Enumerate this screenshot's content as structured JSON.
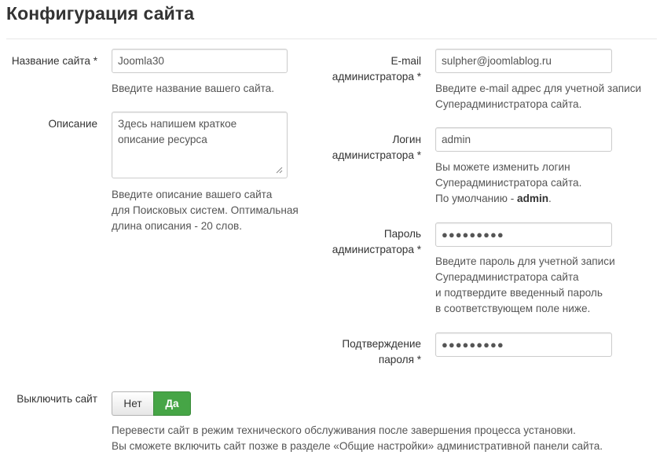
{
  "page_title": "Конфигурация сайта",
  "left": {
    "site_name": {
      "label": "Название сайта *",
      "value": "Joomla30",
      "help": "Введите название вашего сайта."
    },
    "description": {
      "label": "Описание",
      "value": "Здесь напишем краткое описание ресурса",
      "help": [
        "Введите описание вашего сайта",
        "для Поисковых систем. Оптимальная",
        "длина описания - 20 слов."
      ]
    }
  },
  "right": {
    "admin_email": {
      "label": [
        "E-mail",
        "администратора *"
      ],
      "value": "sulpher@joomlablog.ru",
      "help": [
        "Введите e-mail адрес для учетной записи",
        "Суперадминистратора сайта."
      ]
    },
    "admin_login": {
      "label": [
        "Логин",
        "администратора *"
      ],
      "value": "admin",
      "help": [
        "Вы можете изменить логин",
        "Суперадминистратора сайта."
      ],
      "help_default_prefix": "По умолчанию - ",
      "help_default_value": "admin",
      "help_default_suffix": "."
    },
    "admin_password": {
      "label": [
        "Пароль",
        "администратора *"
      ],
      "value": "●●●●●●●●●",
      "help": [
        "Введите пароль для учетной записи",
        "Суперадминистратора сайта",
        "и подтвердите введенный пароль",
        "в соответствующем поле ниже."
      ]
    },
    "password_confirm": {
      "label": [
        "Подтверждение",
        "пароля *"
      ],
      "value": "●●●●●●●●●"
    }
  },
  "offline": {
    "label": "Выключить сайт",
    "no_label": "Нет",
    "yes_label": "Да",
    "selected": "Да",
    "help": [
      "Перевести сайт в режим технического обслуживания после завершения процесса установки.",
      "Вы сможете включить сайт позже в разделе «Общие настройки» административной панели сайта."
    ]
  },
  "colors": {
    "toggle_active": "#46a546",
    "input_border": "#cccccc",
    "help_text": "#555555"
  }
}
